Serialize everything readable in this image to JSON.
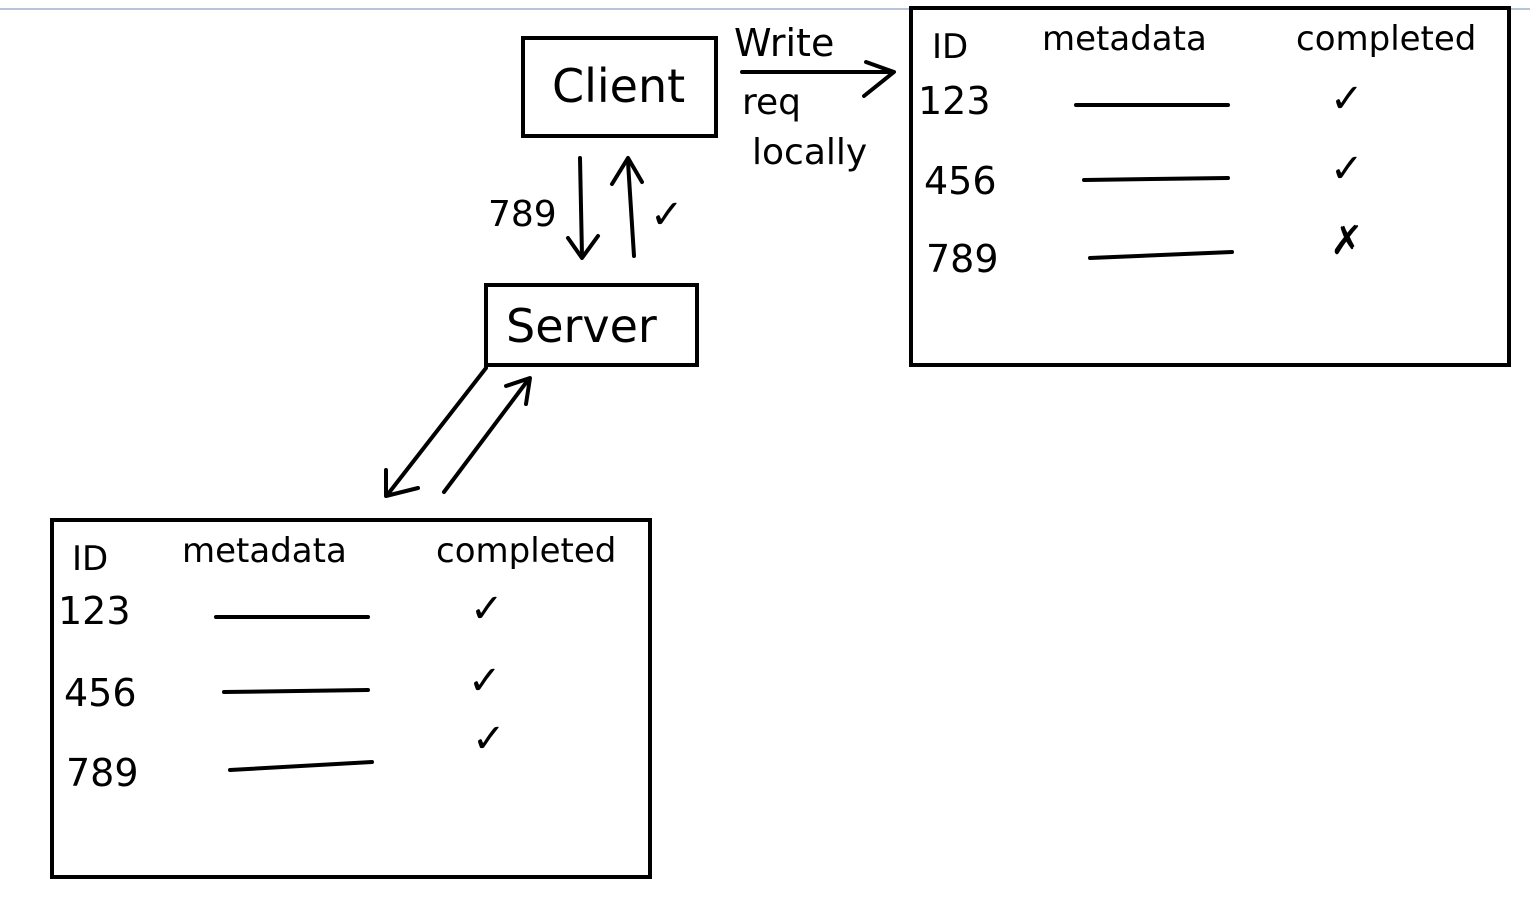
{
  "colors": {
    "ink": "#000000",
    "background": "#ffffff",
    "top_rule": "#b8c4d8"
  },
  "client": {
    "label": "Client"
  },
  "server": {
    "label": "Server"
  },
  "client_server_link": {
    "down_label": "789",
    "up_mark": "✓"
  },
  "write_arrow": {
    "line1": "Write",
    "line2": "req",
    "line3": "locally"
  },
  "local_table": {
    "headers": [
      "ID",
      "metadata",
      "completed"
    ],
    "rows": [
      {
        "id": "123",
        "completed": "✓"
      },
      {
        "id": "456",
        "completed": "✓"
      },
      {
        "id": "789",
        "completed": "✗"
      }
    ]
  },
  "server_table": {
    "headers": [
      "ID",
      "metadata",
      "completed"
    ],
    "rows": [
      {
        "id": "123",
        "completed": "✓"
      },
      {
        "id": "456",
        "completed": "✓"
      },
      {
        "id": "789",
        "completed": "✓"
      }
    ]
  }
}
